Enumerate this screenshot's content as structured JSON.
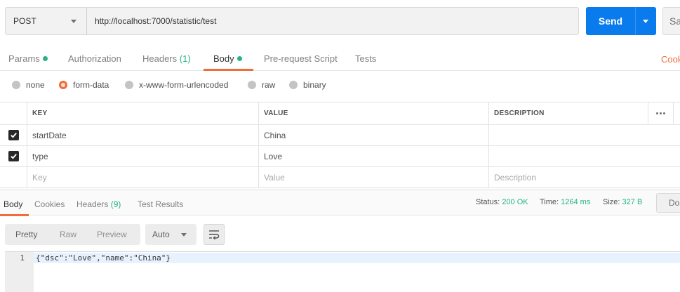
{
  "request": {
    "method": "POST",
    "url": "http://localhost:7000/statistic/test",
    "send_label": "Send",
    "save_label": "Sa"
  },
  "request_tabs": [
    {
      "label": "Params",
      "indicator": true
    },
    {
      "label": "Authorization"
    },
    {
      "label": "Headers",
      "count": "(1)"
    },
    {
      "label": "Body",
      "indicator": true,
      "active": true
    },
    {
      "label": "Pre-request Script"
    },
    {
      "label": "Tests"
    }
  ],
  "cookies_link": "Cook",
  "body_types": [
    {
      "label": "none",
      "selected": false
    },
    {
      "label": "form-data",
      "selected": true
    },
    {
      "label": "x-www-form-urlencoded",
      "selected": false
    },
    {
      "label": "raw",
      "selected": false
    },
    {
      "label": "binary",
      "selected": false
    }
  ],
  "table": {
    "headers": {
      "key": "KEY",
      "value": "VALUE",
      "description": "DESCRIPTION"
    },
    "rows": [
      {
        "checked": true,
        "key": "startDate",
        "value": "China",
        "description": ""
      },
      {
        "checked": true,
        "key": "type",
        "value": "Love",
        "description": ""
      }
    ],
    "placeholders": {
      "key": "Key",
      "value": "Value",
      "description": "Description"
    }
  },
  "response_tabs": [
    {
      "label": "Body",
      "active": true
    },
    {
      "label": "Cookies"
    },
    {
      "label": "Headers",
      "count": "(9)"
    },
    {
      "label": "Test Results"
    }
  ],
  "status": {
    "status_label": "Status:",
    "status_value": "200 OK",
    "time_label": "Time:",
    "time_value": "1264 ms",
    "size_label": "Size:",
    "size_value": "327 B",
    "download_label": "Do"
  },
  "view_modes": [
    "Pretty",
    "Raw",
    "Preview"
  ],
  "active_view_mode": "Pretty",
  "format": "Auto",
  "response_body": {
    "line_number": "1",
    "code": "{\"dsc\":\"Love\",\"name\":\"China\"}"
  },
  "colors": {
    "accent_orange": "#f26b3a",
    "send_blue": "#097bed",
    "success_green": "#26b47f"
  }
}
